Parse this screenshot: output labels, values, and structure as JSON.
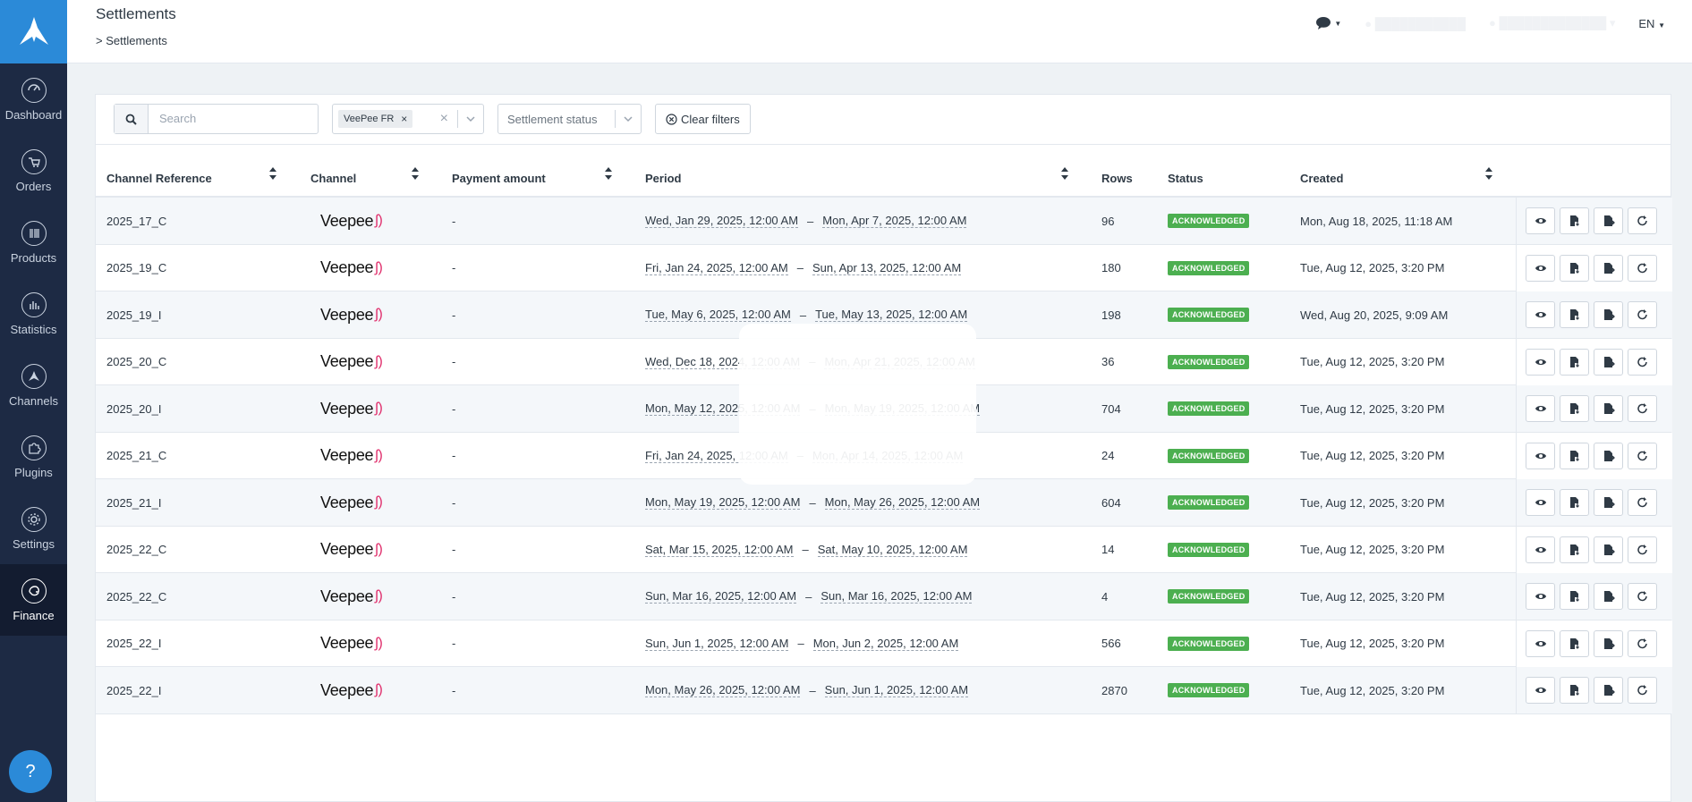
{
  "header": {
    "title": "Settlements",
    "breadcrumb_current": "> Settlements",
    "language": "EN"
  },
  "sidebar": {
    "items": [
      {
        "label": "Dashboard",
        "icon": "gauge-icon"
      },
      {
        "label": "Orders",
        "icon": "cart-icon"
      },
      {
        "label": "Products",
        "icon": "barcode-icon"
      },
      {
        "label": "Statistics",
        "icon": "bar-chart-icon"
      },
      {
        "label": "Channels",
        "icon": "channels-icon"
      },
      {
        "label": "Plugins",
        "icon": "puzzle-icon"
      },
      {
        "label": "Settings",
        "icon": "gear-icon"
      },
      {
        "label": "Finance",
        "icon": "finance-icon",
        "active": true
      }
    ],
    "help_label": "?"
  },
  "filters": {
    "search_placeholder": "Search",
    "channel_chip": "VeePee FR",
    "status_placeholder": "Settlement status",
    "clear_label": "Clear filters"
  },
  "table": {
    "columns": [
      "Channel Reference",
      "Channel",
      "Payment amount",
      "Period",
      "Rows",
      "Status",
      "Created"
    ],
    "rows": [
      {
        "ref": "2025_17_C",
        "channel": "Veepee",
        "amount": "-",
        "start": "Wed, Jan 29, 2025, 12:00 AM",
        "end": "Mon, Apr 7, 2025, 12:00 AM",
        "rows": "96",
        "status": "ACKNOWLEDGED",
        "created": "Mon, Aug 18, 2025, 11:18 AM"
      },
      {
        "ref": "2025_19_C",
        "channel": "Veepee",
        "amount": "-",
        "start": "Fri, Jan 24, 2025, 12:00 AM",
        "end": "Sun, Apr 13, 2025, 12:00 AM",
        "rows": "180",
        "status": "ACKNOWLEDGED",
        "created": "Tue, Aug 12, 2025, 3:20 PM"
      },
      {
        "ref": "2025_19_I",
        "channel": "Veepee",
        "amount": "-",
        "start": "Tue, May 6, 2025, 12:00 AM",
        "end": "Tue, May 13, 2025, 12:00 AM",
        "rows": "198",
        "status": "ACKNOWLEDGED",
        "created": "Wed, Aug 20, 2025, 9:09 AM"
      },
      {
        "ref": "2025_20_C",
        "channel": "Veepee",
        "amount": "-",
        "start": "Wed, Dec 18, 2024, 12:00 AM",
        "end": "Mon, Apr 21, 2025, 12:00 AM",
        "rows": "36",
        "status": "ACKNOWLEDGED",
        "created": "Tue, Aug 12, 2025, 3:20 PM"
      },
      {
        "ref": "2025_20_I",
        "channel": "Veepee",
        "amount": "-",
        "start": "Mon, May 12, 2025, 12:00 AM",
        "end": "Mon, May 19, 2025, 12:00 AM",
        "rows": "704",
        "status": "ACKNOWLEDGED",
        "created": "Tue, Aug 12, 2025, 3:20 PM"
      },
      {
        "ref": "2025_21_C",
        "channel": "Veepee",
        "amount": "-",
        "start": "Fri, Jan 24, 2025, 12:00 AM",
        "end": "Mon, Apr 14, 2025, 12:00 AM",
        "rows": "24",
        "status": "ACKNOWLEDGED",
        "created": "Tue, Aug 12, 2025, 3:20 PM"
      },
      {
        "ref": "2025_21_I",
        "channel": "Veepee",
        "amount": "-",
        "start": "Mon, May 19, 2025, 12:00 AM",
        "end": "Mon, May 26, 2025, 12:00 AM",
        "rows": "604",
        "status": "ACKNOWLEDGED",
        "created": "Tue, Aug 12, 2025, 3:20 PM"
      },
      {
        "ref": "2025_22_C",
        "channel": "Veepee",
        "amount": "-",
        "start": "Sat, Mar 15, 2025, 12:00 AM",
        "end": "Sat, May 10, 2025, 12:00 AM",
        "rows": "14",
        "status": "ACKNOWLEDGED",
        "created": "Tue, Aug 12, 2025, 3:20 PM"
      },
      {
        "ref": "2025_22_C",
        "channel": "Veepee",
        "amount": "-",
        "start": "Sun, Mar 16, 2025, 12:00 AM",
        "end": "Sun, Mar 16, 2025, 12:00 AM",
        "rows": "4",
        "status": "ACKNOWLEDGED",
        "created": "Tue, Aug 12, 2025, 3:20 PM"
      },
      {
        "ref": "2025_22_I",
        "channel": "Veepee",
        "amount": "-",
        "start": "Sun, Jun 1, 2025, 12:00 AM",
        "end": "Mon, Jun 2, 2025, 12:00 AM",
        "rows": "566",
        "status": "ACKNOWLEDGED",
        "created": "Tue, Aug 12, 2025, 3:20 PM"
      },
      {
        "ref": "2025_22_I",
        "channel": "Veepee",
        "amount": "-",
        "start": "Mon, May 26, 2025, 12:00 AM",
        "end": "Sun, Jun 1, 2025, 12:00 AM",
        "rows": "2870",
        "status": "ACKNOWLEDGED",
        "created": "Tue, Aug 12, 2025, 3:20 PM"
      }
    ]
  },
  "colors": {
    "sidebar": "#1d2a44",
    "logo_bg": "#2b8ad8",
    "badge": "#4caf50",
    "veepee_accent": "#e0306d"
  }
}
